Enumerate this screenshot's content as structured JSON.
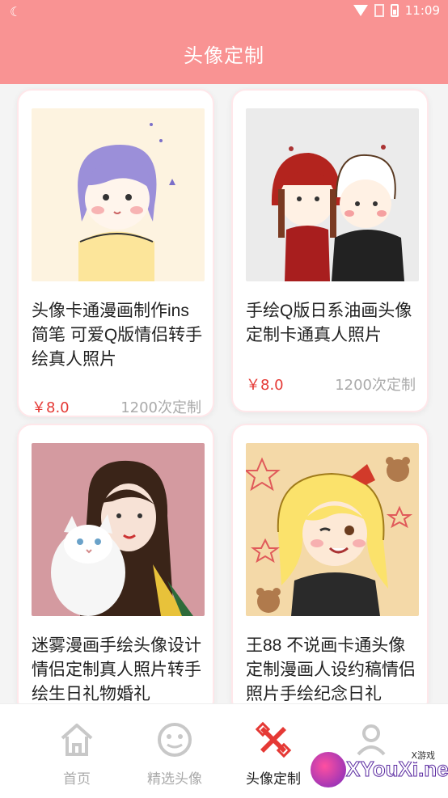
{
  "status_bar": {
    "time": "11:09"
  },
  "header": {
    "title": "头像定制"
  },
  "products": [
    {
      "title": "头像卡通漫画制作ins简笔 可爱Q版情侣转手绘真人照片",
      "price": "￥8.0",
      "count": "1200次定制"
    },
    {
      "title": "手绘Q版日系油画头像定制卡通真人照片",
      "price": "￥8.0",
      "count": "1200次定制"
    },
    {
      "title": "迷雾漫画手绘头像设计情侣定制真人照片转手绘生日礼物婚礼",
      "price": "",
      "count": ""
    },
    {
      "title": "王88 不说画卡通头像定制漫画人设约稿情侣照片手绘纪念日礼",
      "price": "",
      "count": ""
    }
  ],
  "bottom_nav": [
    {
      "label": "首页",
      "icon": "home-icon"
    },
    {
      "label": "精选头像",
      "icon": "smiley-icon"
    },
    {
      "label": "头像定制",
      "icon": "customize-icon"
    },
    {
      "label": "",
      "icon": "profile-icon"
    }
  ],
  "watermark": {
    "text": "XYouXi.net",
    "small": "X游戏"
  },
  "colors": {
    "primary": "#f99393",
    "price": "#e53935",
    "active_icon": "#e53935"
  }
}
